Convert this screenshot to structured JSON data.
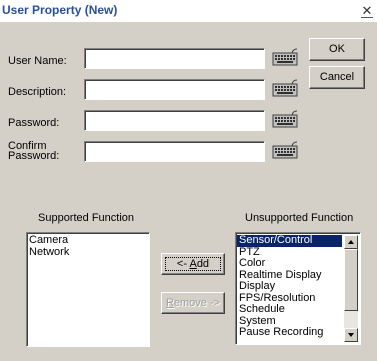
{
  "window": {
    "title": "User Property (New)",
    "close_glyph": "✕"
  },
  "form": {
    "user_name_label": "User Name:",
    "user_name_value": "",
    "description_label": "Description:",
    "description_value": "",
    "password_label": "Password:",
    "password_value": "",
    "confirm_password_label_line1": "Confirm",
    "confirm_password_label_line2": "Password:",
    "confirm_password_value": "",
    "keyboard_icon": "keyboard-icon"
  },
  "buttons": {
    "ok_label": "OK",
    "cancel_label": "Cancel",
    "add_label": "<- Add",
    "remove_label": "Remove ->"
  },
  "supported": {
    "header": "Supported Function",
    "items": [
      "Camera",
      "Network"
    ]
  },
  "unsupported": {
    "header": "Unsupported Function",
    "selected_index": 0,
    "items": [
      "Sensor/Control",
      "PTZ",
      "Color",
      "Realtime Display",
      "Display",
      "FPS/Resolution",
      "Schedule",
      "System",
      "Pause Recording"
    ]
  },
  "colors": {
    "dialog_face": "#d4d0c8",
    "title_text": "#2a4f9a",
    "selection": "#0a246a"
  }
}
